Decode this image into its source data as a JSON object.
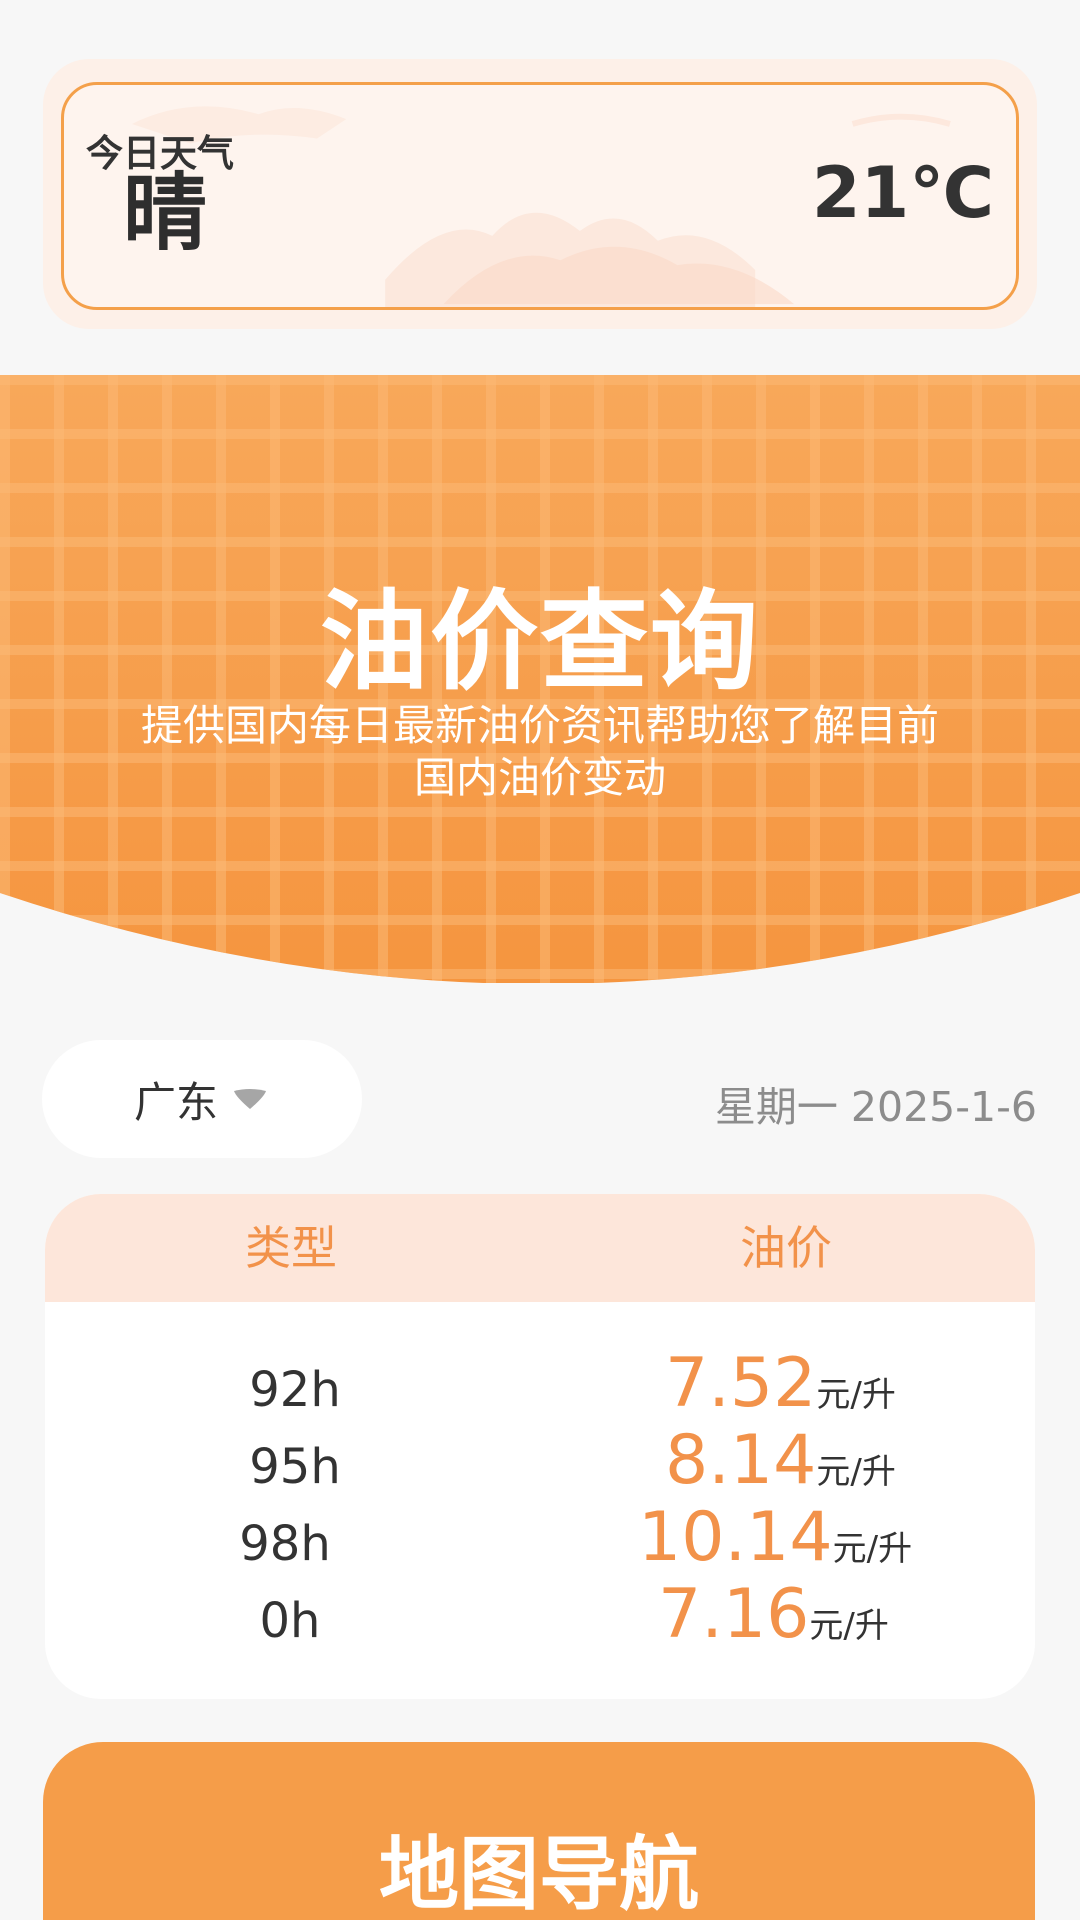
{
  "weather": {
    "label": "今日天气",
    "condition": "晴",
    "temperature": "21℃"
  },
  "banner": {
    "title": "油价查询",
    "subtitle": "提供国内每日最新油价资讯帮助您了解目前国内油价变动"
  },
  "filter": {
    "province": "广东",
    "date": "星期一 2025-1-6"
  },
  "price_table": {
    "headers": [
      "类型",
      "油价"
    ],
    "unit": "元/升",
    "rows": [
      {
        "type": "92h",
        "price": "7.52"
      },
      {
        "type": "95h",
        "price": "8.14"
      },
      {
        "type": "98h",
        "price": "10.14"
      },
      {
        "type": "0h",
        "price": "7.16"
      }
    ]
  },
  "map_nav": {
    "title": "地图导航",
    "subtitle": ""
  },
  "colors": {
    "accent": "#f59d49",
    "price_text": "#f2924a",
    "header_bg": "#fde6da",
    "weather_border": "#f4a04a"
  }
}
